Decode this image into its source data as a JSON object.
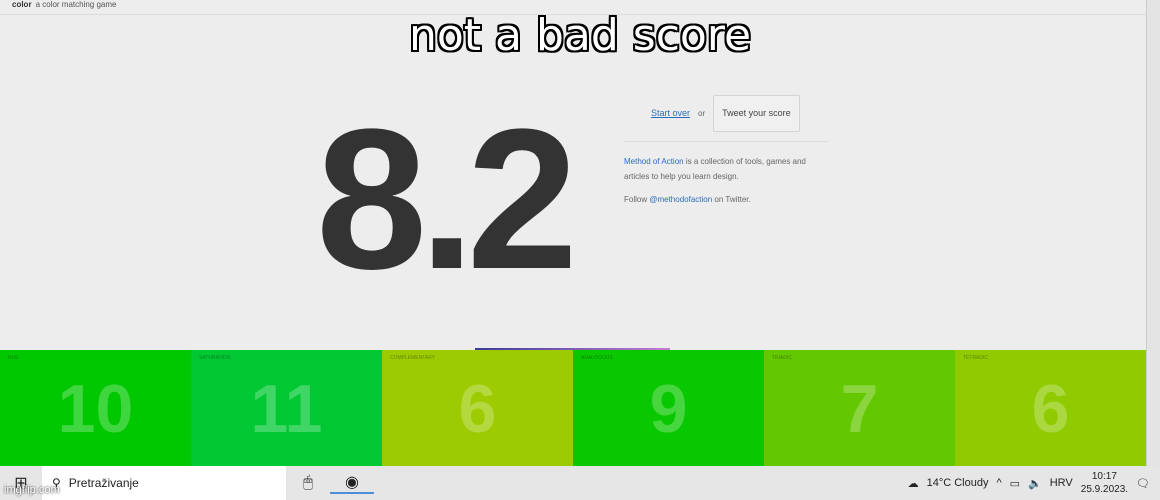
{
  "header": {
    "brand": "color",
    "tagline": "a color matching game"
  },
  "meme_caption": "not a bad score",
  "score": "8.2",
  "side": {
    "start_over": "Start over",
    "or": "or",
    "tweet": "Tweet your score",
    "about_link": "Method of Action",
    "about_text": " is a collection of tools, games and articles to help you learn design.",
    "follow_pre": "Follow ",
    "follow_link": "@methodofaction",
    "follow_post": " on Twitter."
  },
  "tiles": [
    {
      "label": "Hue",
      "value": "10",
      "color": "#00c800"
    },
    {
      "label": "Saturation",
      "value": "11",
      "color": "#00c832"
    },
    {
      "label": "Complementary",
      "value": "6",
      "color": "#9bcb00"
    },
    {
      "label": "Analogous",
      "value": "9",
      "color": "#0ac800"
    },
    {
      "label": "Triadic",
      "value": "7",
      "color": "#64c800"
    },
    {
      "label": "Tetradic",
      "value": "6",
      "color": "#8fcb00"
    }
  ],
  "taskbar": {
    "search": "Pretraživanje",
    "weather": "14°C  Cloudy",
    "lang": "HRV",
    "time": "10:17",
    "date": "25.9.2023."
  },
  "watermark": "imgflip.com"
}
